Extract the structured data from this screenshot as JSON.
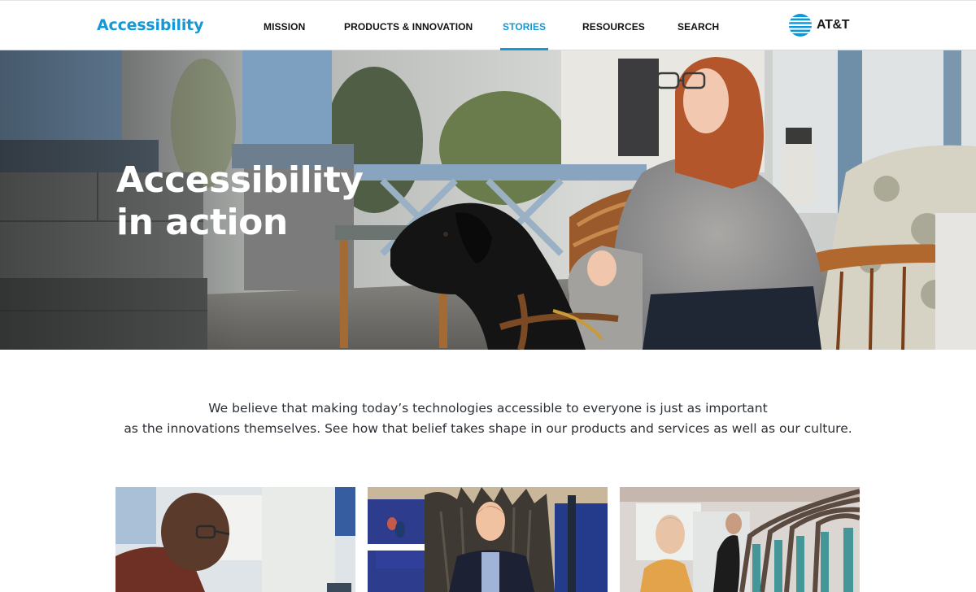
{
  "header": {
    "brand": "Accessibility",
    "nav": [
      {
        "label": "MISSION",
        "active": false
      },
      {
        "label": "PRODUCTS & INNOVATION",
        "active": false
      },
      {
        "label": "STORIES",
        "active": true
      },
      {
        "label": "RESOURCES",
        "active": false
      },
      {
        "label": "SEARCH",
        "active": false
      }
    ],
    "logo_text": "AT&T"
  },
  "hero": {
    "title_line1": "Accessibility",
    "title_line2": "in action"
  },
  "intro": {
    "line1": "We believe that making today’s technologies accessible to everyone is just as important",
    "line2": "as the innovations themselves. See how that belief takes shape in our products and services as well as our culture."
  },
  "stories": [
    {
      "image": "man-with-glasses-at-desk"
    },
    {
      "image": "man-on-iron-throne-at-expo"
    },
    {
      "image": "woman-at-transit-gates"
    }
  ],
  "colors": {
    "accent": "#1698d4",
    "text": "#2b3036",
    "header_bg": "#ffffff"
  }
}
